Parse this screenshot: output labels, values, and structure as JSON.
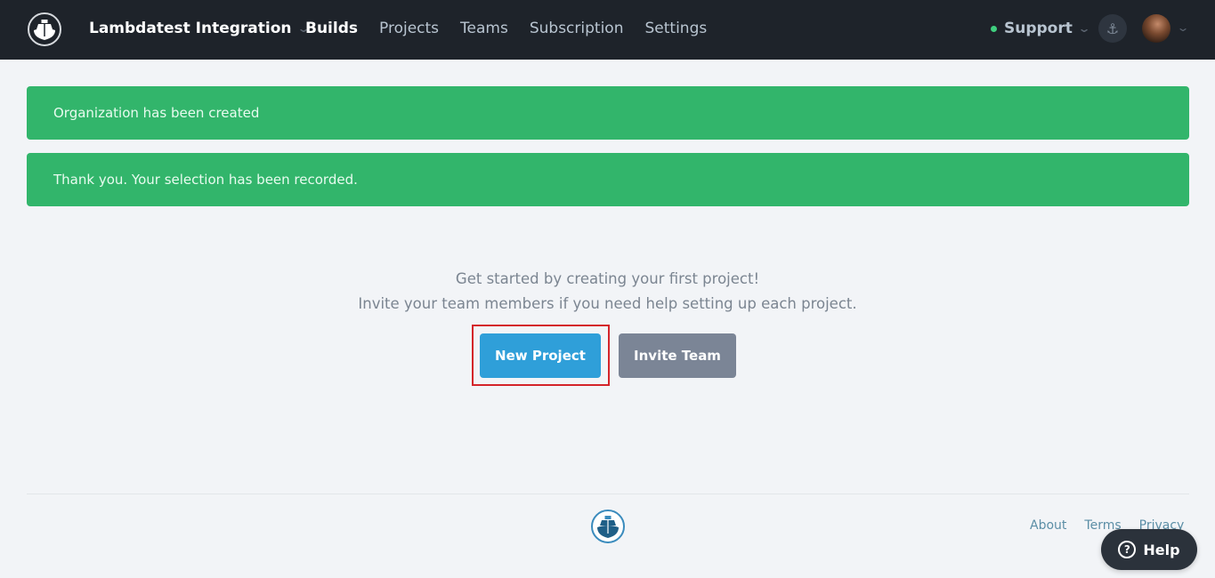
{
  "navbar": {
    "org_name": "Lambdatest Integration",
    "links": [
      {
        "label": "Builds",
        "active": true
      },
      {
        "label": "Projects",
        "active": false
      },
      {
        "label": "Teams",
        "active": false
      },
      {
        "label": "Subscription",
        "active": false
      },
      {
        "label": "Settings",
        "active": false
      }
    ],
    "support_label": "Support",
    "support_status_color": "#3fcf7f",
    "logo_icon": "ship-icon",
    "anchor_icon": "anchor-icon",
    "anchor_glyph": "⚓",
    "chevron_glyph": "⌄"
  },
  "alerts": [
    {
      "message": "Organization has been created"
    },
    {
      "message": "Thank you. Your selection has been recorded."
    }
  ],
  "empty_state": {
    "line1": "Get started by creating your first project!",
    "line2": "Invite your team members if you need help setting up each project.",
    "primary_button": "New Project",
    "secondary_button": "Invite Team"
  },
  "footer": {
    "links": [
      "About",
      "Terms",
      "Privacy"
    ]
  },
  "help": {
    "label": "Help",
    "icon_glyph": "?"
  },
  "colors": {
    "navbar_bg": "#1e232a",
    "alert_success": "#32b56b",
    "primary": "#2f9fd9",
    "secondary": "#7b8596",
    "highlight": "#d4242a"
  }
}
